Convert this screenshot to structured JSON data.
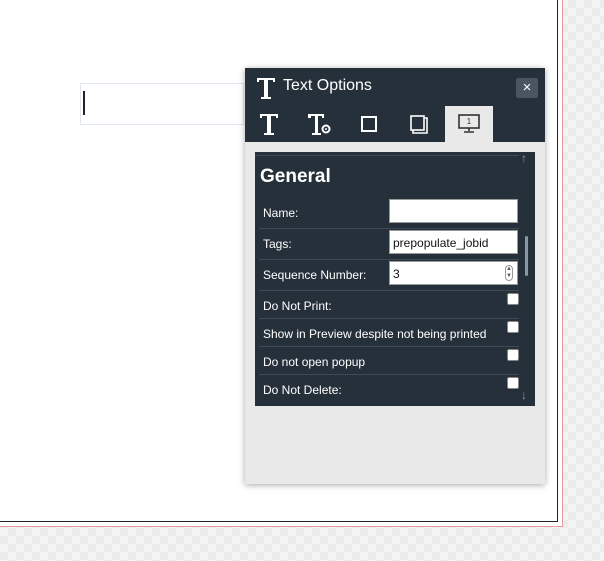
{
  "panel": {
    "title": "Text Options",
    "close_label": "×",
    "tabs": [
      {
        "icon": "text-icon"
      },
      {
        "icon": "text-settings-icon"
      },
      {
        "icon": "border-square-icon"
      },
      {
        "icon": "shadow-box-icon"
      },
      {
        "icon": "monitor-icon",
        "badge": "1",
        "active": true
      }
    ]
  },
  "general": {
    "section_title": "General",
    "name_label": "Name:",
    "name_value": "",
    "tags_label": "Tags:",
    "tags_value": "prepopulate_jobid",
    "sequence_label": "Sequence Number:",
    "sequence_value": "3",
    "do_not_print_label": "Do Not Print:",
    "show_in_preview_label": "Show in Preview despite not being printed",
    "do_not_open_popup_label": "Do not open popup",
    "do_not_delete_label": "Do Not Delete:"
  },
  "colors": {
    "panel_dark": "#26303b",
    "panel_light": "#e9e9e9"
  }
}
